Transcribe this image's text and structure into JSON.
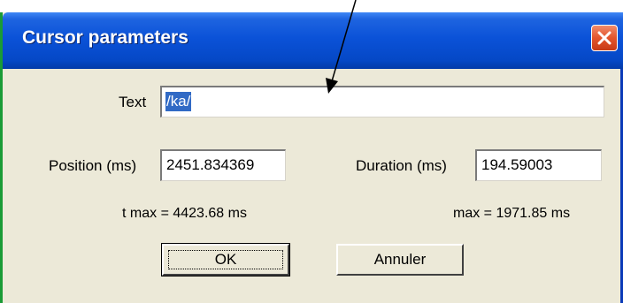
{
  "dialog": {
    "title": "Cursor parameters",
    "close_icon": "close-icon"
  },
  "text_field": {
    "label": "Text",
    "value": "/ka/"
  },
  "position_field": {
    "label": "Position (ms)",
    "value": "2451.834369",
    "limit": "t max = 4423.68 ms"
  },
  "duration_field": {
    "label": "Duration (ms)",
    "value": "194.59003",
    "limit": "max = 1971.85 ms"
  },
  "buttons": {
    "ok_label": "OK",
    "cancel_label": "Annuler"
  },
  "colors": {
    "titlebar": "#0b52d8",
    "dialog_bg": "#ece9d8",
    "selection": "#316ac5",
    "close_button": "#e3542c"
  }
}
